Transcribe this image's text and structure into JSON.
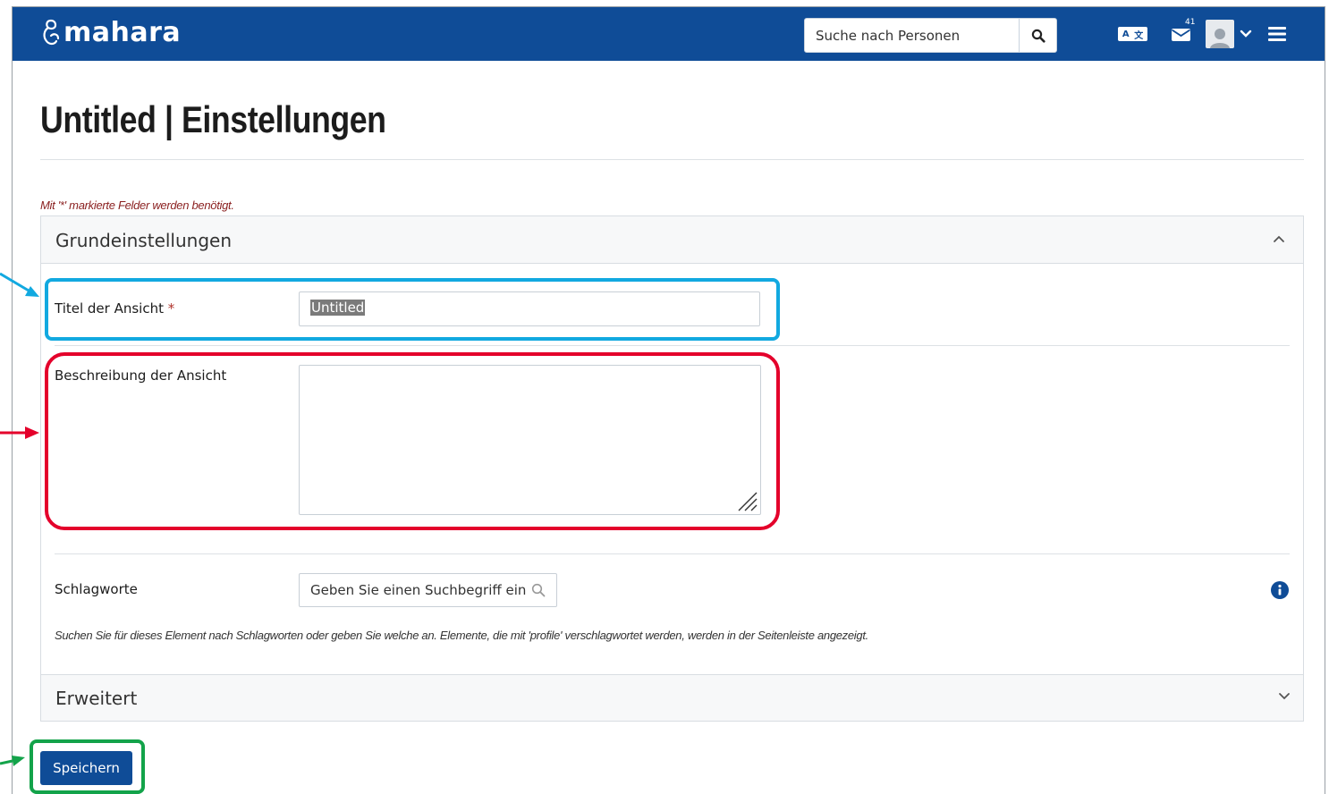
{
  "app": {
    "logo_text": "mahara"
  },
  "header": {
    "search_placeholder": "Suche nach Personen",
    "lang_icon_text_a": "A",
    "lang_icon_text_b": "文",
    "mail_count": "41"
  },
  "page": {
    "title": "Untitled | Einstellungen",
    "required_note": "Mit '*' markierte Felder werden benötigt."
  },
  "basic": {
    "legend": "Grundeinstellungen",
    "title_label": "Titel der Ansicht",
    "required_star": "*",
    "title_value": "Untitled",
    "description_label": "Beschreibung der Ansicht",
    "description_value": "",
    "tags_label": "Schlagworte",
    "tags_placeholder": "Geben Sie einen Suchbegriff ein",
    "tags_help": "Suchen Sie für dieses Element nach Schlagworten oder geben Sie welche an. Elemente, die mit 'profile' verschlagwortet werden, werden in der Seitenleiste angezeigt."
  },
  "advanced": {
    "legend": "Erweitert"
  },
  "actions": {
    "save_label": "Speichern"
  },
  "colors": {
    "brand": "#0f4c97",
    "highlight_title": "#12a9e0",
    "highlight_description": "#e4002b",
    "highlight_save": "#13a34a",
    "required": "#b0332b"
  },
  "icons": {
    "search": "search-icon",
    "language": "language-icon",
    "mail": "mail-icon",
    "user": "user-avatar-icon",
    "menu": "hamburger-menu-icon",
    "info": "info-icon"
  }
}
